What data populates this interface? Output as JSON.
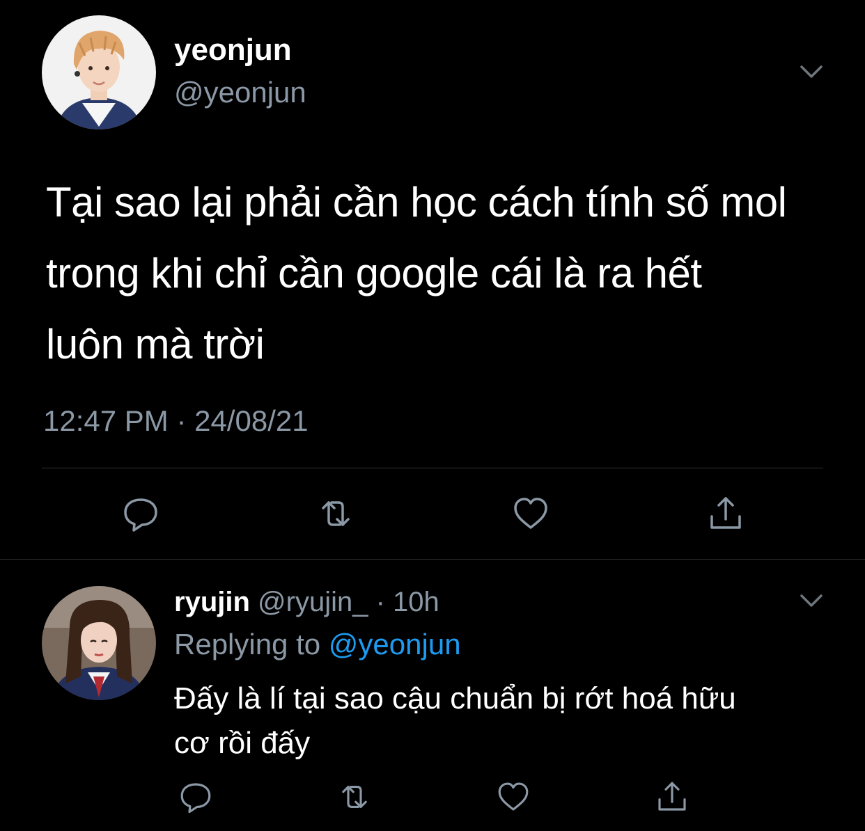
{
  "colors": {
    "background": "#000000",
    "text_primary": "#ffffff",
    "text_secondary": "#8b98a5",
    "link": "#1d9bf0",
    "divider": "#2f3336"
  },
  "main_tweet": {
    "display_name": "yeonjun",
    "handle": "@yeonjun",
    "text_lines": [
      "Tại sao lại phải cần học cách tính số mol",
      "trong khi chỉ cần google cái là ra hết",
      "luôn mà trời"
    ],
    "timestamp": "12:47 PM · 24/08/21",
    "icons": {
      "menu": "chevron-down-icon",
      "reply": "reply-icon",
      "retweet": "retweet-icon",
      "like": "heart-icon",
      "share": "share-icon"
    }
  },
  "reply_tweet": {
    "display_name": "ryujin",
    "handle": "@ryujin_",
    "separator": " · ",
    "time": "10h",
    "replying_prefix": "Replying to ",
    "replying_to": "@yeonjun",
    "text_lines": [
      "Đấy là lí tại sao cậu chuẩn bị rớt hoá hữu",
      "cơ rồi đấy"
    ],
    "icons": {
      "menu": "chevron-down-icon",
      "reply": "reply-icon",
      "retweet": "retweet-icon",
      "like": "heart-icon",
      "share": "share-icon"
    }
  }
}
